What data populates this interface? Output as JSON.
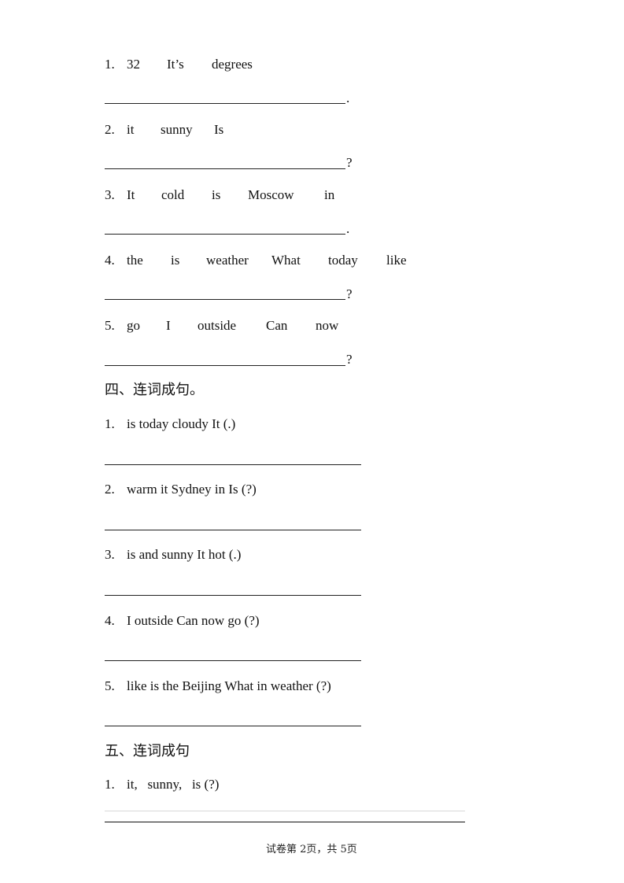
{
  "part_three": {
    "items": [
      {
        "num": "1.",
        "words": [
          "32",
          "It’s",
          "degrees"
        ],
        "end": "."
      },
      {
        "num": "2.",
        "words": [
          "it",
          "sunny",
          "Is"
        ],
        "end": "?"
      },
      {
        "num": "3.",
        "words": [
          "It",
          "cold",
          "is",
          "Moscow",
          "in"
        ],
        "end": "."
      },
      {
        "num": "4.",
        "words": [
          "the",
          "is",
          "weather",
          "What",
          "today",
          "like"
        ],
        "end": "?"
      },
      {
        "num": "5.",
        "words": [
          "go",
          "I",
          "outside",
          "Can",
          "now"
        ],
        "end": "?"
      }
    ]
  },
  "part_four": {
    "heading": "四、连词成句。",
    "items": [
      {
        "num": "1.",
        "text": "is today cloudy It   (.)"
      },
      {
        "num": "2.",
        "text": "warm it Sydney in Is   (?)"
      },
      {
        "num": "3.",
        "text": "is and sunny It hot (.)"
      },
      {
        "num": "4.",
        "text": "I outside Can now go (?)"
      },
      {
        "num": "5.",
        "text": "like is the Beijing What in weather (?)"
      }
    ]
  },
  "part_five": {
    "heading": "五、连词成句",
    "items": [
      {
        "num": "1.",
        "text": "it,   sunny,   is (?)"
      }
    ]
  },
  "footer": {
    "page_label": "试卷第 2页，共 5页"
  }
}
